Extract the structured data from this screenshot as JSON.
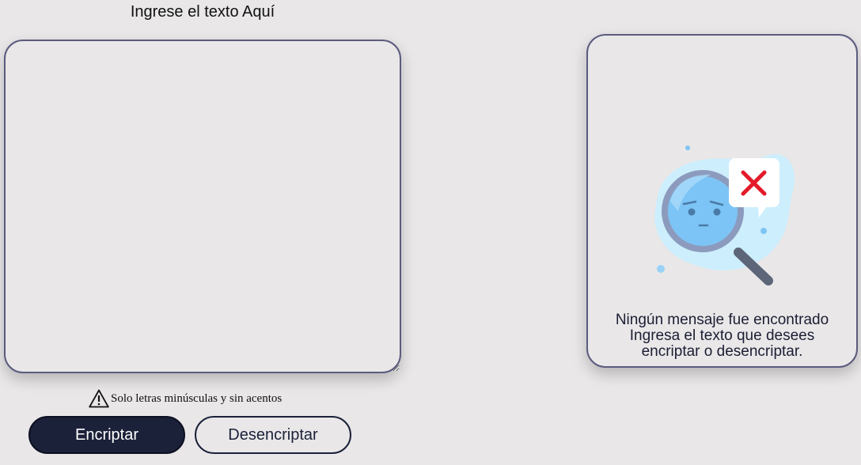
{
  "input": {
    "title": "Ingrese el texto Aquí",
    "value": "",
    "placeholder": ""
  },
  "hint": {
    "icon": "warning-triangle-icon",
    "text": "Solo letras minúsculas y sin acentos"
  },
  "buttons": {
    "encrypt_label": "Encriptar",
    "decrypt_label": "Desencriptar"
  },
  "output": {
    "illustration": "magnifier-not-found-illustration",
    "title": "Ningún mensaje fue encontrado",
    "line1": "Ingresa el texto que desees",
    "line2": "encriptar o desencriptar."
  },
  "colors": {
    "background": "#e9e7e8",
    "primary_dark": "#1b2139",
    "border": "#5b5b7e",
    "error_red": "#e31b2a",
    "lens_blue": "#7ec5f3"
  }
}
